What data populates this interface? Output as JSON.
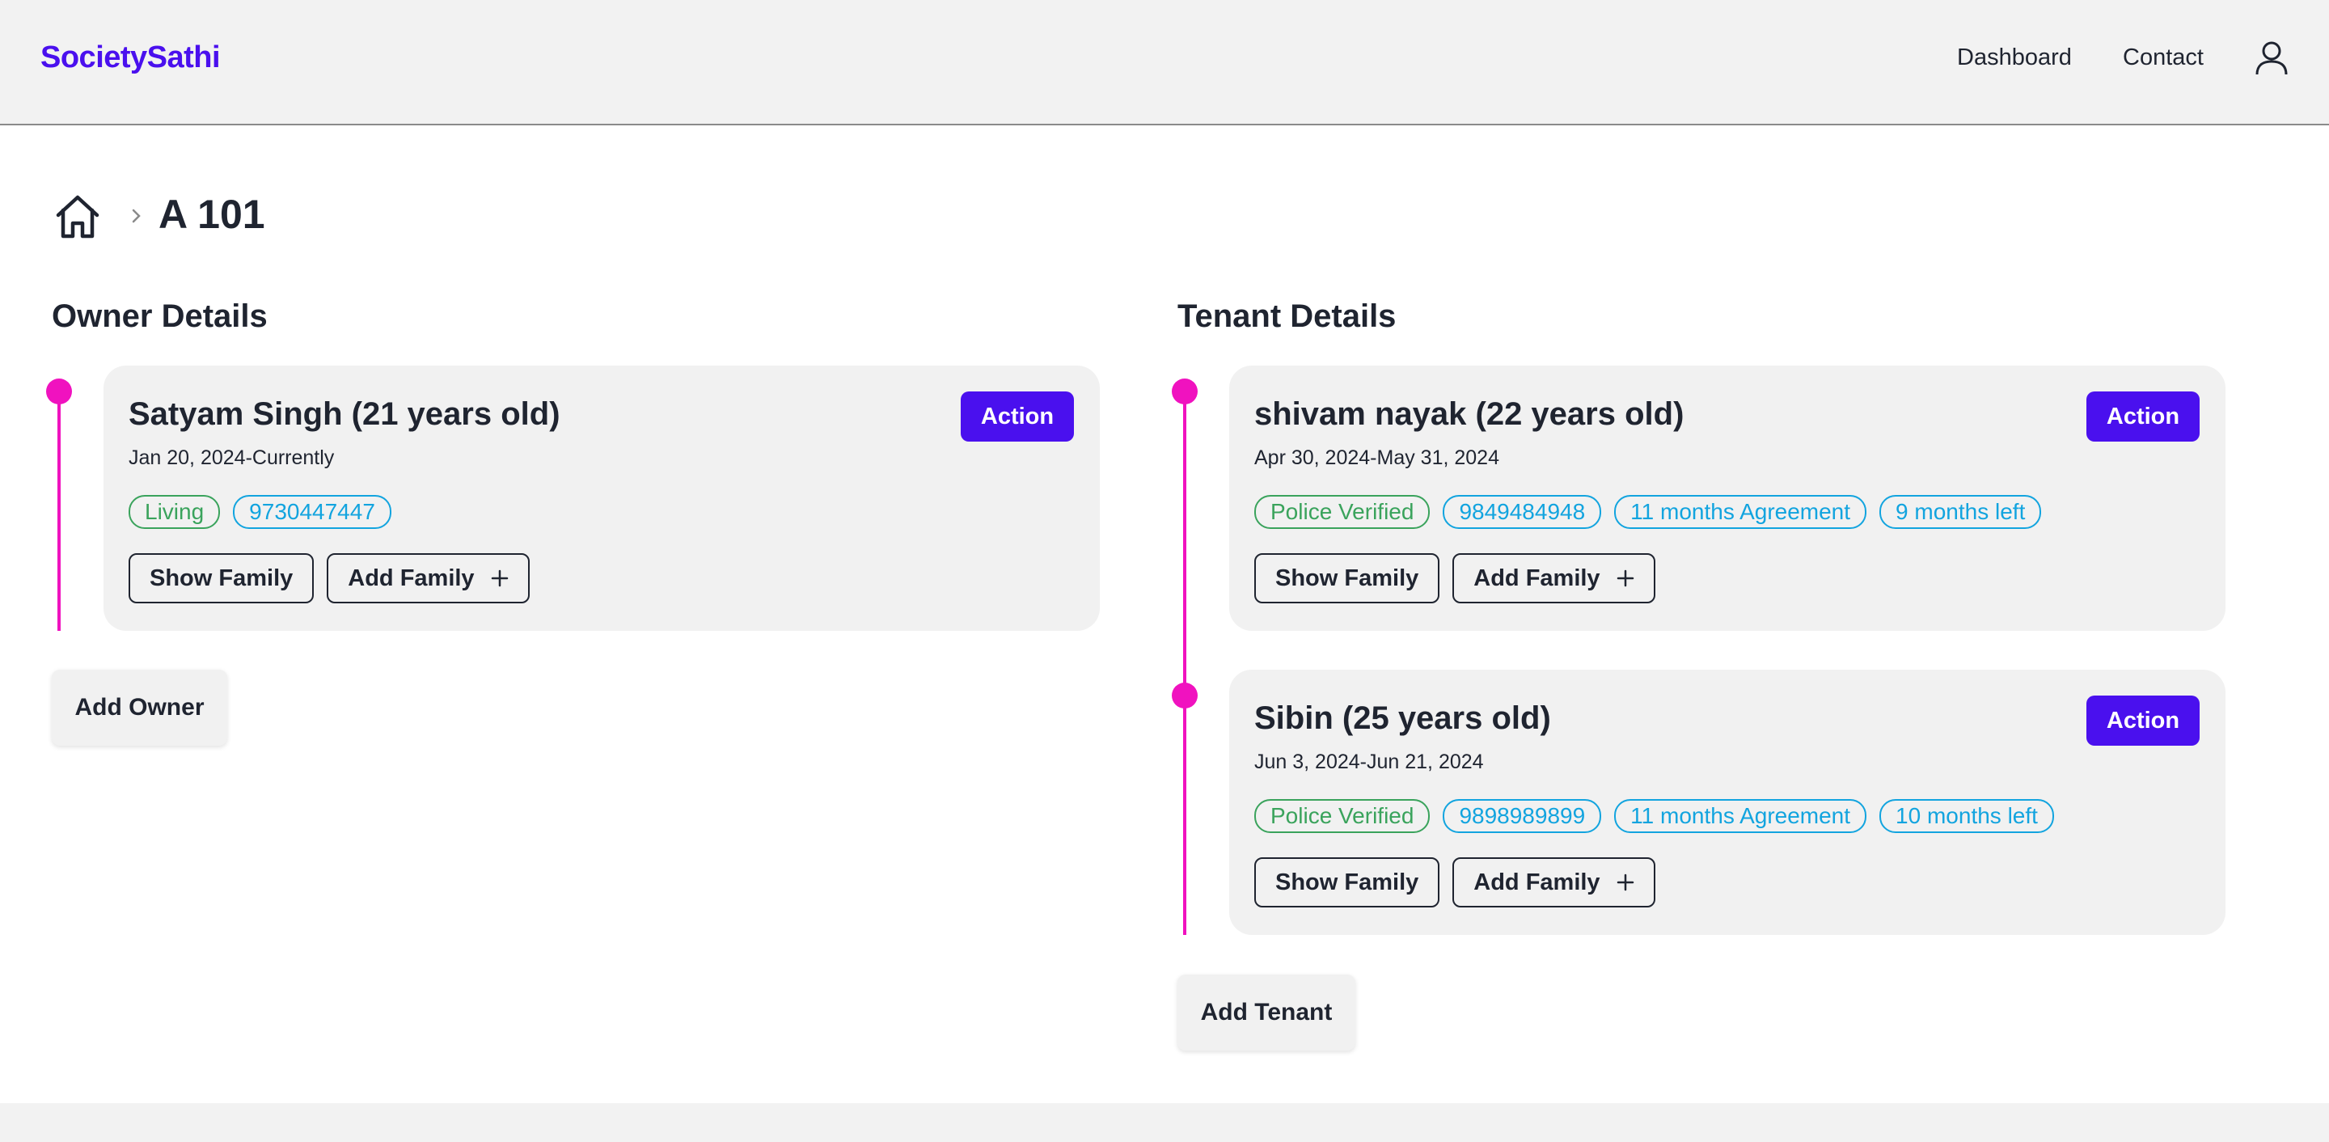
{
  "header": {
    "brand": "SocietySathi",
    "nav": [
      {
        "label": "Dashboard"
      },
      {
        "label": "Contact"
      }
    ],
    "user_icon": "user-icon"
  },
  "breadcrumb": {
    "home_icon": "home-icon",
    "separator_icon": "chevron-right-icon",
    "current": "A 101"
  },
  "accent_colors": {
    "brand": "#4a10ee",
    "timeline": "#f012bf",
    "badge_green": "#3aa35c",
    "badge_blue": "#12a4df"
  },
  "owner": {
    "section_title": "Owner Details",
    "cards": [
      {
        "name": "Satyam Singh (21 years old)",
        "dates": "Jan 20, 2024-Currently",
        "action_label": "Action",
        "badges": [
          {
            "text": "Living",
            "color": "green"
          },
          {
            "text": "9730447447",
            "color": "blue"
          }
        ],
        "show_family_label": "Show Family",
        "add_family_label": "Add Family"
      }
    ],
    "add_button_label": "Add Owner"
  },
  "tenant": {
    "section_title": "Tenant Details",
    "cards": [
      {
        "name": "shivam nayak (22 years old)",
        "dates": "Apr 30, 2024-May 31, 2024",
        "action_label": "Action",
        "badges": [
          {
            "text": "Police Verified",
            "color": "green"
          },
          {
            "text": "9849484948",
            "color": "blue"
          },
          {
            "text": "11 months Agreement",
            "color": "blue"
          },
          {
            "text": "9 months left",
            "color": "blue"
          }
        ],
        "show_family_label": "Show Family",
        "add_family_label": "Add Family"
      },
      {
        "name": "Sibin (25 years old)",
        "dates": "Jun 3, 2024-Jun 21, 2024",
        "action_label": "Action",
        "badges": [
          {
            "text": "Police Verified",
            "color": "green"
          },
          {
            "text": "9898989899",
            "color": "blue"
          },
          {
            "text": "11 months Agreement",
            "color": "blue"
          },
          {
            "text": "10 months left",
            "color": "blue"
          }
        ],
        "show_family_label": "Show Family",
        "add_family_label": "Add Family"
      }
    ],
    "add_button_label": "Add Tenant"
  }
}
